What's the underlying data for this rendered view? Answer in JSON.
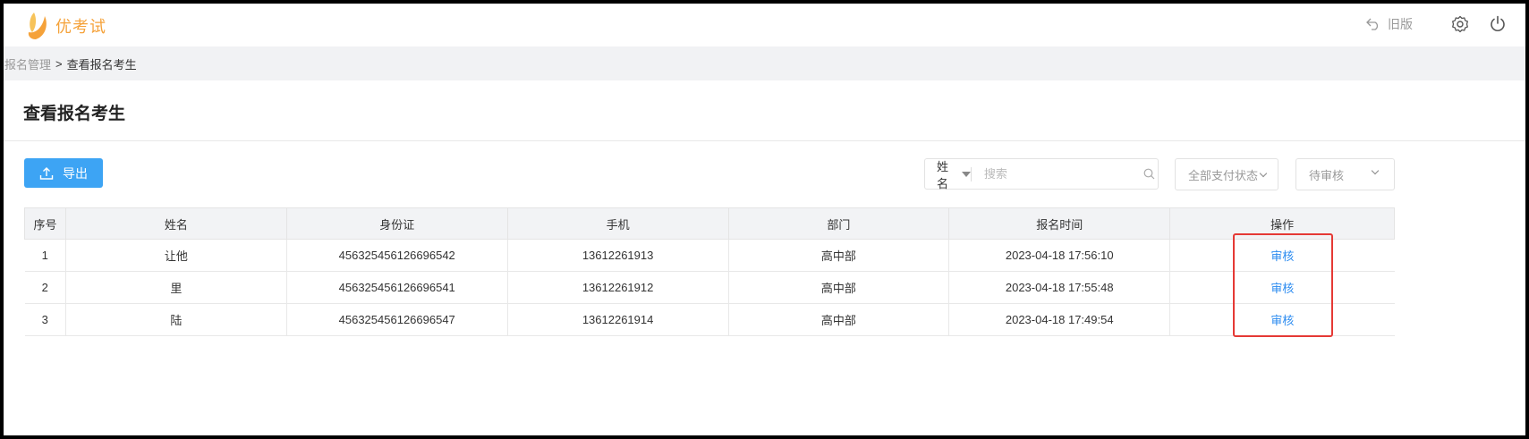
{
  "header": {
    "logo_text": "优考试",
    "old_version_label": "旧版"
  },
  "breadcrumb": {
    "parent": "报名管理",
    "separator": ">",
    "current": "查看报名考生"
  },
  "page": {
    "title": "查看报名考生"
  },
  "toolbar": {
    "export_label": "导出",
    "search_type": "姓名",
    "search_placeholder": "搜索",
    "payment_filter": "全部支付状态",
    "status_filter": "待审核"
  },
  "table": {
    "columns": [
      "序号",
      "姓名",
      "身份证",
      "手机",
      "部门",
      "报名时间",
      "操作"
    ],
    "rows": [
      {
        "index": "1",
        "name": "让他",
        "id_card": "456325456126696542",
        "phone": "13612261913",
        "dept": "高中部",
        "time": "2023-04-18 17:56:10",
        "action": "审核"
      },
      {
        "index": "2",
        "name": "里",
        "id_card": "456325456126696541",
        "phone": "13612261912",
        "dept": "高中部",
        "time": "2023-04-18 17:55:48",
        "action": "审核"
      },
      {
        "index": "3",
        "name": "陆",
        "id_card": "456325456126696547",
        "phone": "13612261914",
        "dept": "高中部",
        "time": "2023-04-18 17:49:54",
        "action": "审核"
      }
    ]
  },
  "colors": {
    "brand": "#f5a23a",
    "primary": "#3da4f4",
    "link": "#2d8cf0",
    "highlight": "#e53935"
  }
}
